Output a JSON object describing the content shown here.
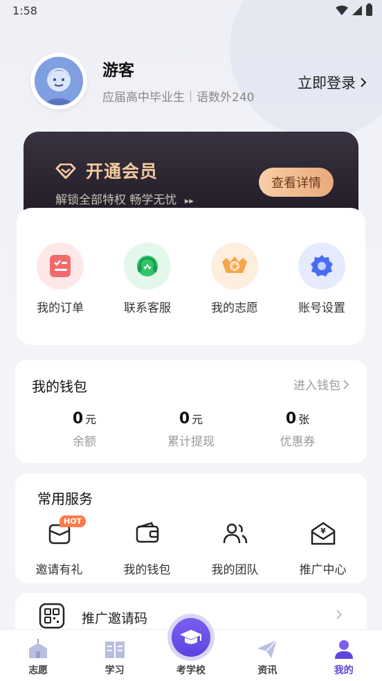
{
  "status_bar": {
    "time": "1:58"
  },
  "profile": {
    "name": "游客",
    "grade": "应届高中毕业生",
    "subject_info": "语数外240",
    "login_label": "立即登录"
  },
  "vip": {
    "title": "开通会员",
    "subtitle": "解锁全部特权 畅学无忧",
    "button": "查看详情"
  },
  "quick_menu": [
    {
      "label": "我的订单",
      "icon": "order-icon"
    },
    {
      "label": "联系客服",
      "icon": "headset-icon"
    },
    {
      "label": "我的志愿",
      "icon": "star-badge-icon"
    },
    {
      "label": "账号设置",
      "icon": "gear-icon"
    }
  ],
  "wallet": {
    "title": "我的钱包",
    "enter_label": "进入钱包",
    "stats": [
      {
        "value": "0",
        "unit": "元",
        "label": "余额"
      },
      {
        "value": "0",
        "unit": "元",
        "label": "累计提现"
      },
      {
        "value": "0",
        "unit": "张",
        "label": "优惠券"
      }
    ]
  },
  "services": {
    "title": "常用服务",
    "items": [
      {
        "label": "邀请有礼",
        "icon": "gift-icon",
        "badge": "HOT"
      },
      {
        "label": "我的钱包",
        "icon": "wallet-icon"
      },
      {
        "label": "我的团队",
        "icon": "team-icon"
      },
      {
        "label": "推广中心",
        "icon": "promo-mail-icon"
      }
    ]
  },
  "invite_code": {
    "label": "推广邀请码"
  },
  "tabs": [
    {
      "label": "志愿",
      "icon": "building-icon"
    },
    {
      "label": "学习",
      "icon": "book-icon"
    },
    {
      "label": "考学校",
      "icon": "graduation-cap-icon"
    },
    {
      "label": "资讯",
      "icon": "paper-plane-icon"
    },
    {
      "label": "我的",
      "icon": "person-icon",
      "active": true
    }
  ],
  "colors": {
    "accent": "#5b45e0",
    "vip_gold": "#f3c99e",
    "hot": "#ff7a4a"
  }
}
